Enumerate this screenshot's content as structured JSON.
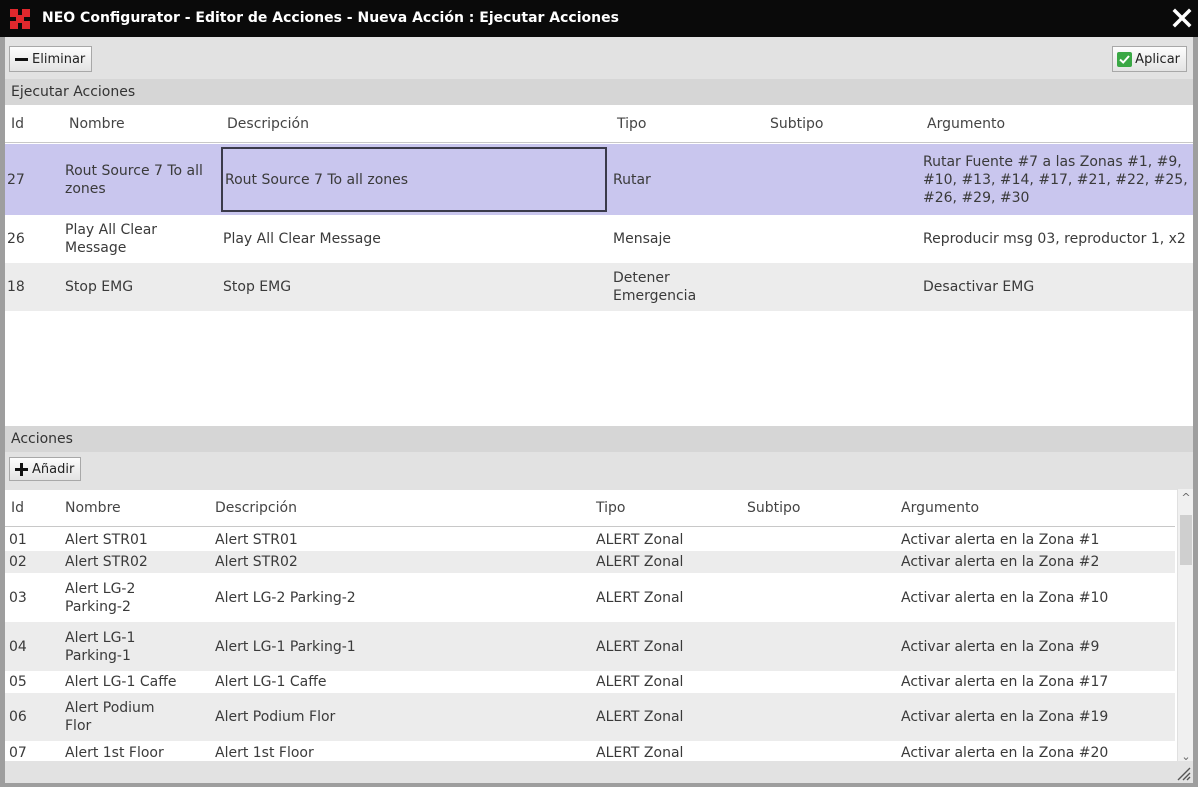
{
  "window": {
    "title": "NEO Configurator - Editor de Acciones - Nueva Acción : Ejecutar Acciones"
  },
  "toolbar": {
    "delete_label": "Eliminar",
    "apply_label": "Aplicar"
  },
  "execute_section": {
    "title": "Ejecutar Acciones",
    "columns": [
      "Id",
      "Nombre",
      "Descripción",
      "Tipo",
      "Subtipo",
      "Argumento"
    ],
    "rows": [
      {
        "id": "27",
        "name": "Rout Source 7 To all zones",
        "description": "Rout Source 7 To all zones",
        "type": "Rutar",
        "subtype": "",
        "argument": "Rutar Fuente #7 a las Zonas #1, #9, #10, #13, #14, #17, #21, #22, #25, #26, #29, #30",
        "selected": true
      },
      {
        "id": "26",
        "name": "Play All Clear Message",
        "description": "Play All Clear Message",
        "type": "Mensaje",
        "subtype": "",
        "argument": "Reproducir msg 03, reproductor 1, x2",
        "selected": false
      },
      {
        "id": "18",
        "name": "Stop EMG",
        "description": "Stop EMG",
        "type": "Detener Emergencia",
        "subtype": "",
        "argument": "Desactivar EMG",
        "selected": false
      }
    ]
  },
  "actions_section": {
    "title": "Acciones",
    "add_label": "Añadir",
    "columns": [
      "Id",
      "Nombre",
      "Descripción",
      "Tipo",
      "Subtipo",
      "Argumento"
    ],
    "rows": [
      {
        "id": "01",
        "name": "Alert STR01",
        "description": "Alert STR01",
        "type": "ALERT Zonal",
        "subtype": "",
        "argument": "Activar alerta en la Zona #1"
      },
      {
        "id": "02",
        "name": "Alert STR02",
        "description": "Alert STR02",
        "type": "ALERT Zonal",
        "subtype": "",
        "argument": "Activar alerta en la Zona #2"
      },
      {
        "id": "03",
        "name": "Alert LG-2 Parking-2",
        "description": "Alert LG-2 Parking-2",
        "type": "ALERT Zonal",
        "subtype": "",
        "argument": "Activar alerta en la Zona #10"
      },
      {
        "id": "04",
        "name": "Alert LG-1 Parking-1",
        "description": "Alert LG-1 Parking-1",
        "type": "ALERT Zonal",
        "subtype": "",
        "argument": "Activar alerta en la Zona #9"
      },
      {
        "id": "05",
        "name": "Alert LG-1 Caffe",
        "description": "Alert LG-1 Caffe",
        "type": "ALERT Zonal",
        "subtype": "",
        "argument": "Activar alerta en la Zona #17"
      },
      {
        "id": "06",
        "name": "Alert Podium Flor",
        "description": "Alert Podium Flor",
        "type": "ALERT Zonal",
        "subtype": "",
        "argument": "Activar alerta en la Zona #19"
      },
      {
        "id": "07",
        "name": "Alert 1st Floor",
        "description": "Alert 1st Floor",
        "type": "ALERT Zonal",
        "subtype": "",
        "argument": "Activar alerta en la Zona #20"
      }
    ]
  },
  "colors": {
    "titlebar": "#0a0a0a",
    "selected_row": "#c9c6ee",
    "logo_red": "#e0282d",
    "check_green": "#3aa845"
  }
}
